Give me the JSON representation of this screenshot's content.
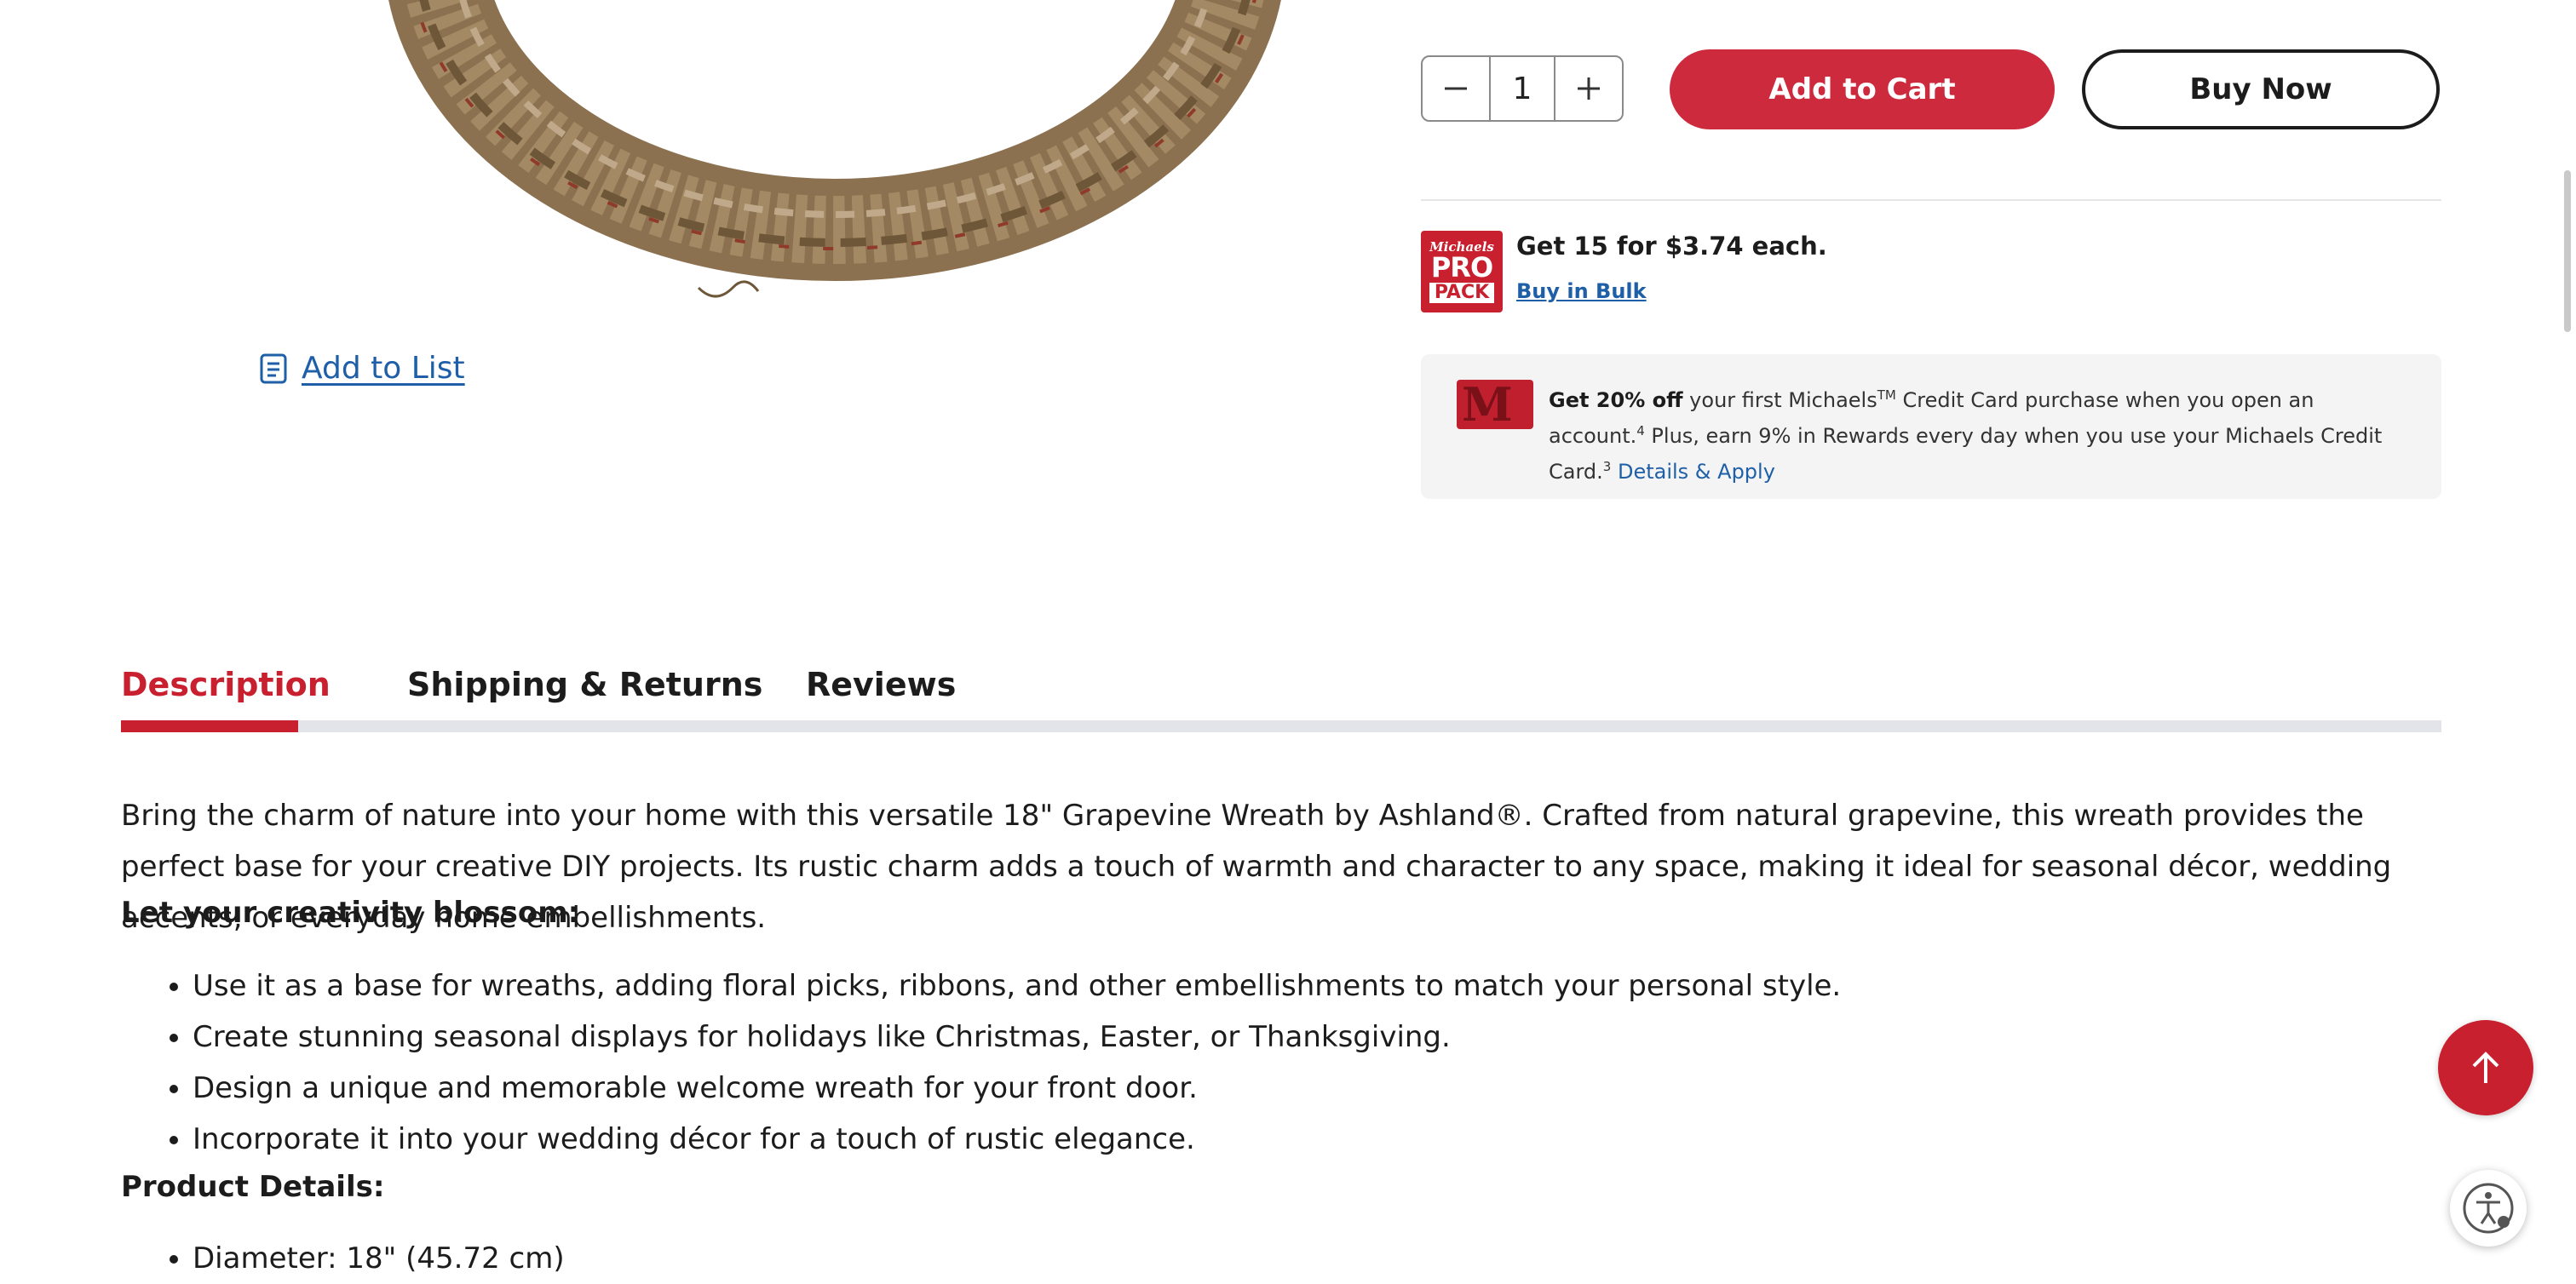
{
  "product_actions": {
    "add_to_list": "Add to List",
    "quantity": "1",
    "add_to_cart": "Add to Cart",
    "buy_now": "Buy Now"
  },
  "pro_pack": {
    "logo_top": "Michaels",
    "logo_mid": "PRO",
    "logo_bottom": "PACK",
    "title": "Get 15 for $3.74 each.",
    "link": "Buy in Bulk"
  },
  "credit_offer": {
    "bold": "Get 20% off",
    "text1": " your first Michaels",
    "tm": "TM",
    "text2": " Credit Card purchase when you open an account.",
    "sup1": "4",
    "text3": " Plus, earn 9% in Rewards every day when you use your Michaels Credit Card.",
    "sup2": "3",
    "link": "Details & Apply"
  },
  "tabs": {
    "description": "Description",
    "shipping": "Shipping & Returns",
    "reviews": "Reviews"
  },
  "description": {
    "intro": "Bring the charm of nature into your home with this versatile 18\" Grapevine Wreath by Ashland®. Crafted from natural grapevine, this wreath provides the perfect base for your creative DIY projects. Its rustic charm adds a touch of warmth and character to any space, making it ideal for seasonal décor, wedding accents, or everyday home embellishments.",
    "creativity_heading": "Let your creativity blossom:",
    "creativity_items": [
      "Use it as a base for wreaths, adding floral picks, ribbons, and other embellishments to match your personal style.",
      "Create stunning seasonal displays for holidays like Christmas, Easter, or Thanksgiving.",
      "Design a unique and memorable welcome wreath for your front door.",
      "Incorporate it into your wedding décor for a touch of rustic elegance."
    ],
    "details_heading": "Product Details:",
    "details_items": [
      "Diameter: 18\" (45.72 cm)"
    ]
  },
  "colors": {
    "brand_red": "#c8202f",
    "link_blue": "#1e5fa8"
  },
  "icons": {
    "list": "list-icon",
    "minus": "minus-icon",
    "plus": "plus-icon",
    "back_to_top": "arrow-up-icon",
    "accessibility": "accessibility-icon"
  }
}
